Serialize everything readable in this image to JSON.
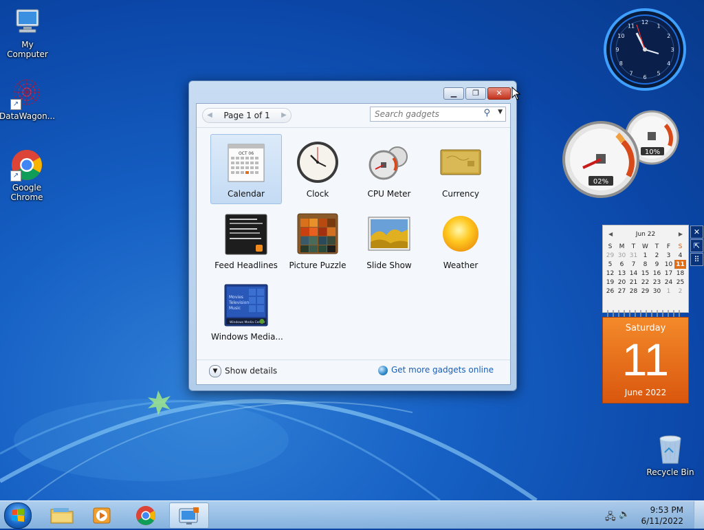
{
  "desktop": {
    "icons": [
      {
        "label": "My Computer"
      },
      {
        "label": "DataWagon..."
      },
      {
        "label": "Google Chrome"
      },
      {
        "label": "Recycle Bin"
      }
    ]
  },
  "gallery": {
    "pager_label": "Page 1 of 1",
    "search_placeholder": "Search gadgets",
    "gadgets": [
      {
        "label": "Calendar"
      },
      {
        "label": "Clock"
      },
      {
        "label": "CPU Meter"
      },
      {
        "label": "Currency"
      },
      {
        "label": "Feed Headlines"
      },
      {
        "label": "Picture Puzzle"
      },
      {
        "label": "Slide Show"
      },
      {
        "label": "Weather"
      },
      {
        "label": "Windows Media..."
      }
    ],
    "icon_text": {
      "calendar_month": "OCT 06",
      "wmc_lines": [
        "Movies",
        "Television",
        "Music"
      ],
      "wmc_caption": "Windows Media Center"
    },
    "show_details": "Show details",
    "get_more": "Get more gadgets online"
  },
  "cpu_meter": {
    "cpu": "02%",
    "memory": "10%"
  },
  "clock_gadget": {
    "numerals": [
      "12",
      "1",
      "2",
      "3",
      "4",
      "5",
      "6",
      "7",
      "8",
      "9",
      "10",
      "11"
    ]
  },
  "calendar_gadget": {
    "month_label": "Jun 22",
    "weekdays": [
      "S",
      "M",
      "T",
      "W",
      "T",
      "F",
      "S"
    ],
    "weeks": [
      [
        "29",
        "30",
        "31",
        "1",
        "2",
        "3",
        "4"
      ],
      [
        "5",
        "6",
        "7",
        "8",
        "9",
        "10",
        "11"
      ],
      [
        "12",
        "13",
        "14",
        "15",
        "16",
        "17",
        "18"
      ],
      [
        "19",
        "20",
        "21",
        "22",
        "23",
        "24",
        "25"
      ],
      [
        "26",
        "27",
        "28",
        "29",
        "30",
        "1",
        "2"
      ]
    ],
    "weekday_name": "Saturday",
    "day_number": "11",
    "month_year": "June 2022"
  },
  "taskbar": {
    "time": "9:53 PM",
    "date": "6/11/2022"
  },
  "colors": {
    "accent_orange": "#e06e18",
    "desktop_blue": "#1660c4",
    "link_blue": "#1a5fb4"
  }
}
